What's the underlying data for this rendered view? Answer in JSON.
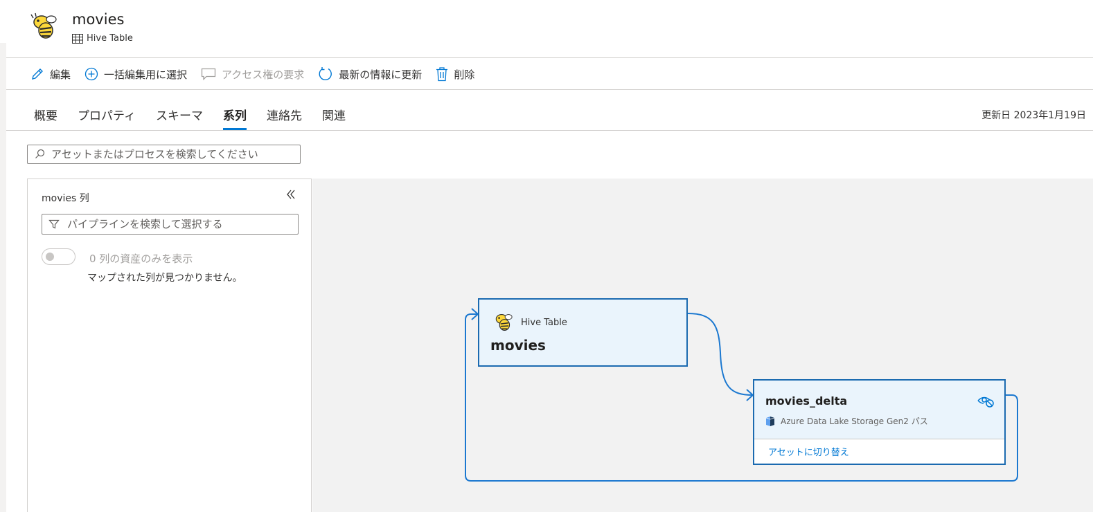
{
  "header": {
    "title": "movies",
    "subtitle": "Hive Table",
    "logo_icon": "hive-bee-icon"
  },
  "toolbar": {
    "edit": "編集",
    "bulk_select": "一括編集用に選択",
    "access_request": "アクセス権の要求",
    "refresh": "最新の情報に更新",
    "delete": "削除"
  },
  "tabs": [
    {
      "label": "概要"
    },
    {
      "label": "プロパティ"
    },
    {
      "label": "スキーマ"
    },
    {
      "label": "系列",
      "active": true
    },
    {
      "label": "連絡先"
    },
    {
      "label": "関連"
    }
  ],
  "updated_text": "更新日 2023年1月19日",
  "search": {
    "placeholder": "アセットまたはプロセスを検索してください"
  },
  "panel": {
    "title": "movies 列",
    "filter_placeholder": "パイプラインを検索して選択する",
    "toggle_label": "0 列の資産のみを表示",
    "toggle_on": false,
    "empty_message": "マップされた列が見つかりません。"
  },
  "nodes": {
    "source": {
      "type": "Hive Table",
      "name": "movies"
    },
    "target": {
      "name": "movies_delta",
      "source_type": "Azure Data Lake Storage Gen2 パス",
      "switch_link": "アセットに切り替え"
    }
  },
  "colors": {
    "accent": "#0078d4",
    "node_border": "#1b6ab0",
    "node_fill": "#eaf4fc",
    "canvas": "#f2f2f2"
  }
}
